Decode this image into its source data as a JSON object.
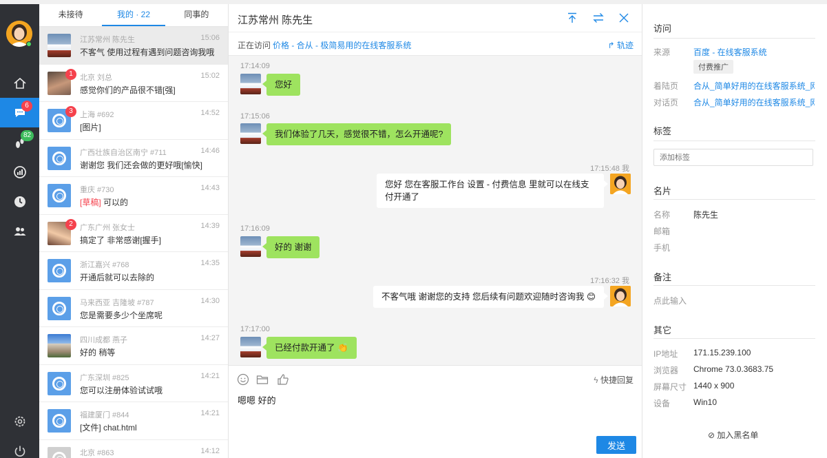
{
  "nav": {
    "items": [
      {
        "name": "home-icon"
      },
      {
        "name": "chat-icon",
        "badge": "6"
      },
      {
        "name": "visitors-icon",
        "badge": "82"
      },
      {
        "name": "stats-icon"
      },
      {
        "name": "history-icon"
      },
      {
        "name": "team-icon"
      }
    ],
    "settings_icon": "gear-icon",
    "power_icon": "power-icon"
  },
  "tabs": [
    {
      "label": "未接待"
    },
    {
      "label": "我的 · 22"
    },
    {
      "label": "同事的"
    }
  ],
  "conversations": [
    {
      "meta": "江苏常州 陈先生",
      "time": "15:06",
      "msg": "不客气 使用过程有遇到问题咨询我哦",
      "avatar": "snow"
    },
    {
      "meta": "北京 刘总",
      "time": "15:02",
      "msg": "感觉你们的产品很不错[强]",
      "avatar": "person1",
      "badge": "1"
    },
    {
      "meta": "上海 #692",
      "time": "14:52",
      "msg": "[图片]",
      "avatar": "chrome",
      "badge": "3"
    },
    {
      "meta": "广西壮族自治区南宁 #711",
      "time": "14:46",
      "msg": "谢谢您 我们还会做的更好哦[愉快]",
      "avatar": "chrome"
    },
    {
      "meta": "重庆 #730",
      "time": "14:43",
      "draft": "[草稿]",
      "msg": " 可以的",
      "avatar": "chrome"
    },
    {
      "meta": "广东广州 张女士",
      "time": "14:39",
      "msg": "搞定了 非常感谢[握手]",
      "avatar": "person2",
      "badge": "2"
    },
    {
      "meta": "浙江嘉兴 #768",
      "time": "14:35",
      "msg": "开通后就可以去除的",
      "avatar": "chrome"
    },
    {
      "meta": "马来西亚 吉隆坡 #787",
      "time": "14:30",
      "msg": "您是需要多少个坐席呢",
      "avatar": "chrome"
    },
    {
      "meta": "四川成都 燕子",
      "time": "14:27",
      "msg": "好的 稍等",
      "avatar": "temple"
    },
    {
      "meta": "广东深圳 #825",
      "time": "14:21",
      "msg": "您可以注册体验试试哦",
      "avatar": "chrome"
    },
    {
      "meta": "福建厦门 #844",
      "time": "14:21",
      "msg": "[文件] chat.html",
      "avatar": "chrome"
    },
    {
      "meta": "北京 #863",
      "time": "14:12",
      "msg": "",
      "avatar": "chrome-grey"
    }
  ],
  "chat": {
    "title": "江苏常州 陈先生",
    "visiting_label": "正在访问",
    "visiting_page": "价格 - 合从 - 极简易用的在线客服系统",
    "track_label": "轨迹",
    "messages": [
      {
        "dir": "in",
        "time": "17:14:09",
        "text": "您好"
      },
      {
        "dir": "in",
        "time": "17:15:06",
        "text": "我们体验了几天，感觉很不错，怎么开通呢?"
      },
      {
        "dir": "out",
        "time": "17:15:48",
        "who": "我",
        "text": "您好 您在客服工作台 设置 - 付费信息 里就可以在线支付开通了"
      },
      {
        "dir": "in",
        "time": "17:16:09",
        "text": "好的 谢谢"
      },
      {
        "dir": "out",
        "time": "17:16:32",
        "who": "我",
        "text": "不客气哦 谢谢您的支持 您后续有问题欢迎随时咨询我 😊"
      },
      {
        "dir": "in",
        "time": "17:17:00",
        "text": "已经付款开通了 👏"
      }
    ],
    "quick_reply_label": "快捷回复",
    "draft": "嗯嗯 好的",
    "send_label": "发送"
  },
  "info": {
    "visit": {
      "title": "访问",
      "source_label": "来源",
      "source_value": "百度 - 在线客服系统",
      "source_tag": "付费推广",
      "landing_label": "着陆页",
      "landing_value": "合从_简单好用的在线客服系统_网...",
      "dialog_label": "对话页",
      "dialog_value": "合从_简单好用的在线客服系统_网..."
    },
    "tags": {
      "title": "标签",
      "placeholder": "添加标签"
    },
    "card": {
      "title": "名片",
      "name_label": "名称",
      "name_value": "陈先生",
      "email_label": "邮箱",
      "phone_label": "手机"
    },
    "note": {
      "title": "备注",
      "placeholder": "点此输入"
    },
    "other": {
      "title": "其它",
      "ip_label": "IP地址",
      "ip_value": "171.15.239.100",
      "browser_label": "浏览器",
      "browser_value": "Chrome 73.0.3683.75",
      "screen_label": "屏幕尺寸",
      "screen_value": "1440 x 900",
      "device_label": "设备",
      "device_value": "Win10"
    },
    "blacklist_label": "加入黑名单"
  },
  "colors": {
    "accent": "#1e88e5",
    "rail": "#2f3136",
    "bubble_in": "#9ee35f",
    "badge": "#f5424d"
  }
}
